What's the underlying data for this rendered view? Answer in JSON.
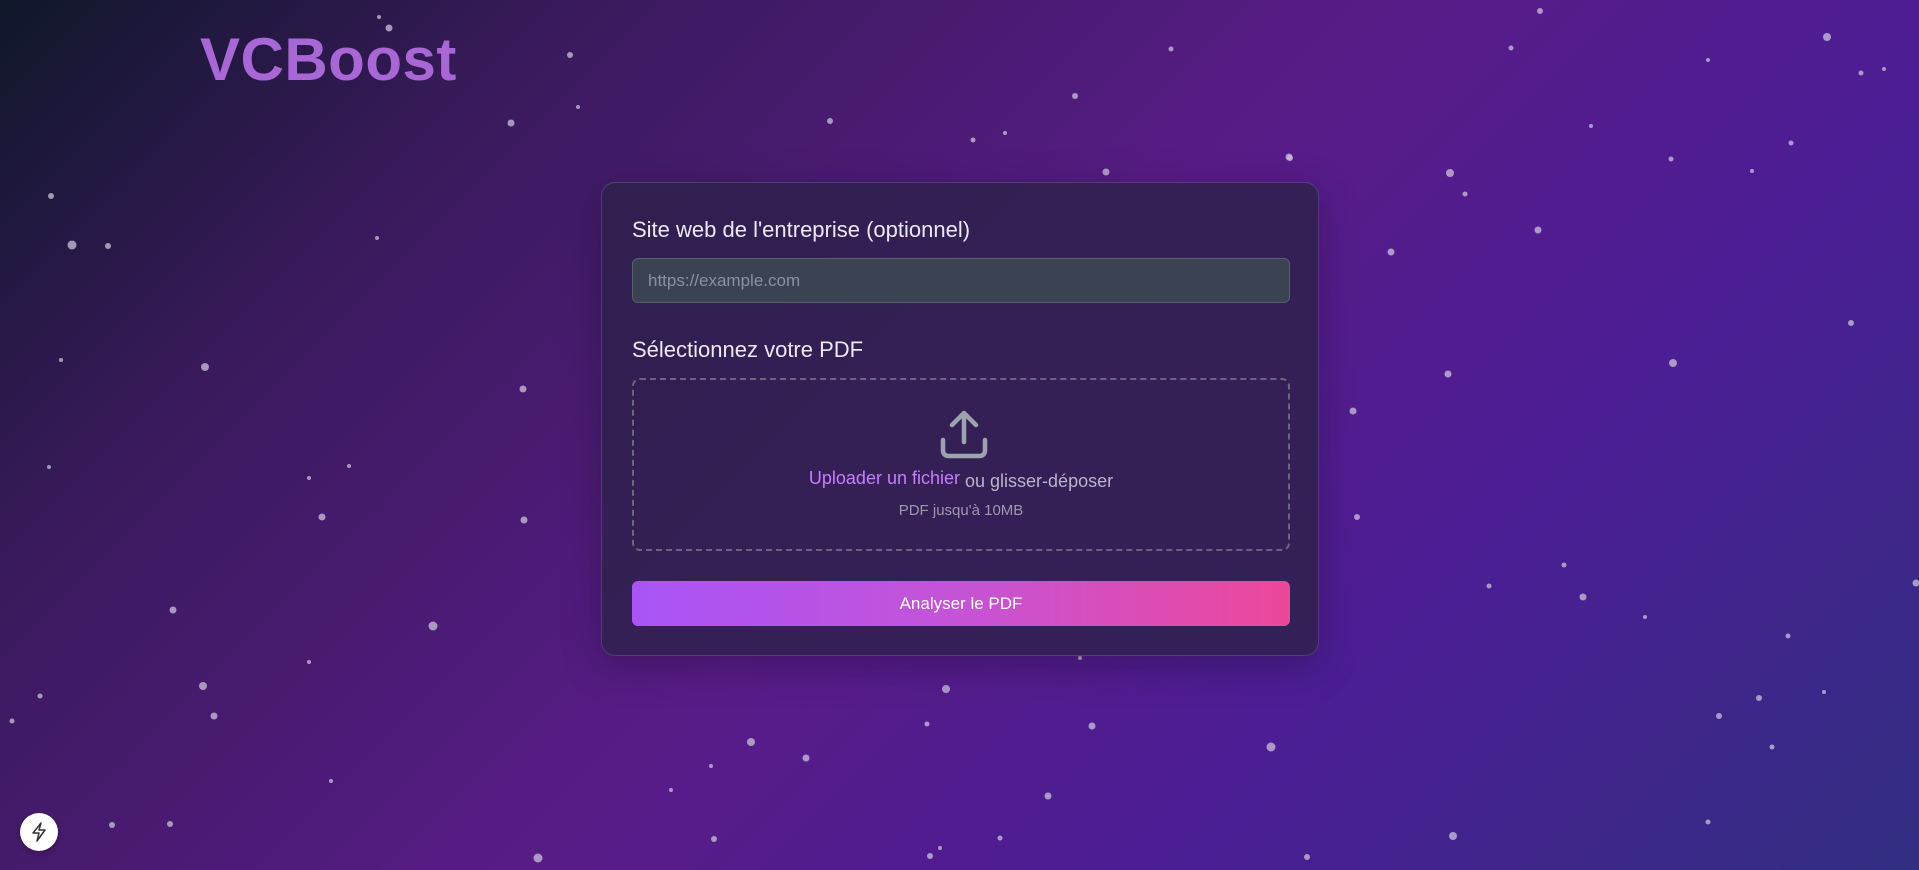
{
  "brand": {
    "logo_text": "VCBoost",
    "color": "#a967d6"
  },
  "form": {
    "website_label": "Site web de l'entreprise (optionnel)",
    "website_placeholder": "https://example.com",
    "website_value": "",
    "pdf_label": "Sélectionnez votre PDF",
    "dropzone": {
      "icon": "upload-icon",
      "upload_link": "Uploader un fichier",
      "drag_text": "ou glisser-déposer",
      "hint": "PDF jusqu'à 10MB"
    },
    "submit_label": "Analyser le PDF"
  },
  "widget": {
    "icon": "lightning-bolt-icon"
  },
  "colors": {
    "accent_purple": "#a855f7",
    "accent_pink": "#ec4899",
    "link": "#c77dff"
  }
}
